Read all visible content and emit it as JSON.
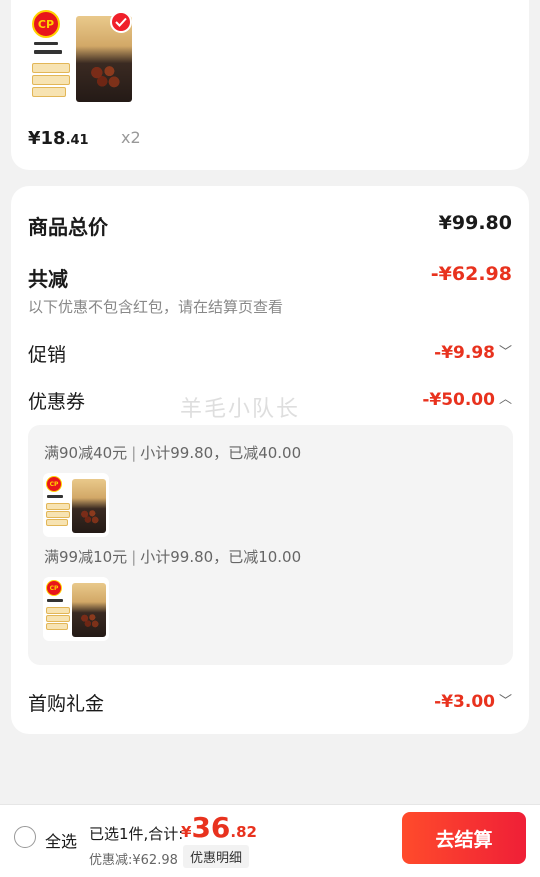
{
  "item": {
    "brand": "CP",
    "price_int": "¥18",
    "price_dec": ".41",
    "quantity": "x2"
  },
  "summary": {
    "total_label": "商品总价",
    "total_value": "¥99.80",
    "discount_label": "共减",
    "discount_value": "-¥62.98",
    "note": "以下优惠不包含红包，请在结算页查看",
    "promo_label": "促销",
    "promo_value": "-¥9.98",
    "coupon_label": "优惠券",
    "coupon_value": "-¥50.00",
    "coupons": [
      {
        "rule": "满90减40元",
        "detail": "小计99.80，已减40.00"
      },
      {
        "rule": "满99减10元",
        "detail": "小计99.80，已减10.00"
      }
    ],
    "gift_label": "首购礼金",
    "gift_value": "-¥3.00"
  },
  "watermark": "羊毛小队长",
  "bottom": {
    "select_all": "全选",
    "selected_text": "已选1件,合计:",
    "total_yen": "¥",
    "total_int": "36",
    "total_dec": ".82",
    "discount_text": "优惠减:¥62.98",
    "detail_button": "优惠明细",
    "checkout_button": "去结算"
  },
  "colors": {
    "accent_red": "#e8321e",
    "button_red": "#ef1f37"
  }
}
